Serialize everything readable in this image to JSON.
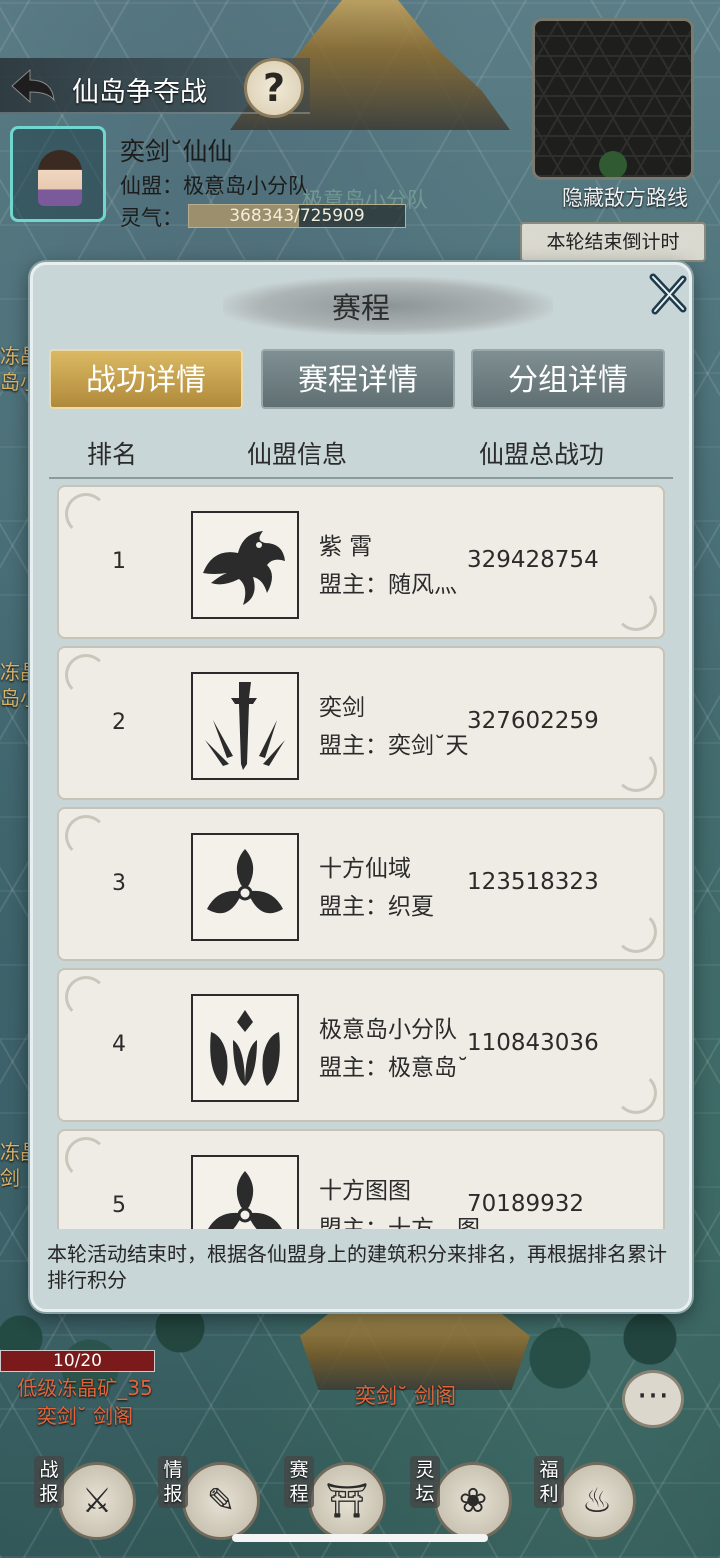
{
  "header": {
    "title": "仙岛争夺战",
    "help_label": "?"
  },
  "player": {
    "name": "奕剑˘仙仙",
    "guild": "仙盟：极意岛小分队",
    "guild_ghost": "极意岛小分队",
    "qi_label": "灵气：",
    "qi_text": "368343/725909",
    "qi_fraction": 0.507
  },
  "minimap": {
    "hide_route_label": "隐藏敌方路线",
    "countdown_label": "本轮结束倒计时"
  },
  "side_labels": [
    "冻晶",
    "岛小",
    "冻晶",
    "岛小",
    "冻晶",
    "剑"
  ],
  "modal": {
    "title": "赛程",
    "tabs": [
      {
        "label": "战功详情",
        "active": true
      },
      {
        "label": "赛程详情",
        "active": false
      },
      {
        "label": "分组详情",
        "active": false
      }
    ],
    "columns": [
      "排名",
      "仙盟信息",
      "仙盟总战功"
    ],
    "rows": [
      {
        "rank": "1",
        "emblem": "dragon-icon",
        "name": "紫 霄",
        "leader": "盟主：随风灬",
        "power": "329428754"
      },
      {
        "rank": "2",
        "emblem": "sword-icon",
        "name": "奕剑",
        "leader": "盟主：奕剑˘天",
        "power": "327602259"
      },
      {
        "rank": "3",
        "emblem": "trefoil-icon",
        "name": "十方仙域",
        "leader": "盟主：织夏",
        "power": "123518323"
      },
      {
        "rank": "4",
        "emblem": "lotus-crest-icon",
        "name": "极意岛小分队",
        "leader": "盟主：极意岛˘",
        "power": "110843036"
      },
      {
        "rank": "5",
        "emblem": "trefoil-icon",
        "name": "十方图图",
        "leader": "盟主：十方、图",
        "power": "70189932"
      }
    ],
    "footnote": "本轮活动结束时，根据各仙盟身上的建筑积分来排名，再根据排名累计排行积分"
  },
  "map": {
    "ore_progress": "10/20",
    "ore_label": "低级冻晶矿_35",
    "ore_owner": "奕剑˘ 剑阁",
    "bottom_guild": "奕剑˘ 剑阁"
  },
  "nav": [
    {
      "label": "战报",
      "icon": "crossed-swords-icon"
    },
    {
      "label": "情报",
      "icon": "scroll-icon"
    },
    {
      "label": "赛程",
      "icon": "gate-icon"
    },
    {
      "label": "灵坛",
      "icon": "lotus-icon"
    },
    {
      "label": "福利",
      "icon": "pouch-icon"
    }
  ],
  "chat_label": "···",
  "colors": {
    "accent_gold": "#c9a24d",
    "modal_bg": "#c9d6d8",
    "ore_red": "#e2643a"
  }
}
